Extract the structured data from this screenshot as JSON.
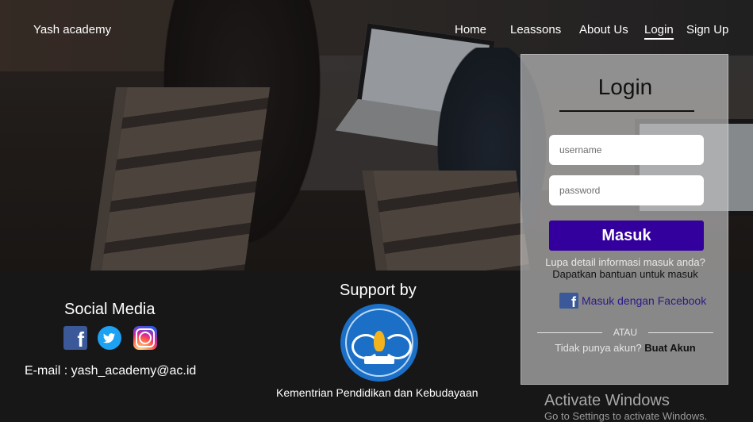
{
  "nav": {
    "brand": "Yash academy",
    "links": [
      {
        "label": "Home"
      },
      {
        "label": "Leassons"
      },
      {
        "label": "About Us"
      },
      {
        "label": "Login"
      },
      {
        "label": "Sign Up"
      }
    ]
  },
  "login": {
    "title": "Login",
    "username_placeholder": "username",
    "password_placeholder": "password",
    "submit_label": "Masuk",
    "forgot_text": "Lupa detail informasi masuk anda?",
    "help_link": "Dapatkan bantuan untuk masuk",
    "facebook_label": "Masuk dengan Facebook",
    "or_text": "ATAU",
    "no_account_text": "Tidak punya akun?",
    "create_account_label": "Buat Akun"
  },
  "footer": {
    "social_title": "Social Media",
    "social_icons": [
      "facebook-icon",
      "twitter-icon",
      "instagram-icon"
    ],
    "email_text": "E-mail : yash_academy@ac.id",
    "support_title": "Support by",
    "ministry_text": "Kementrian Pendidikan dan Kebudayaan"
  },
  "watermark": {
    "title": "Activate Windows",
    "subtitle": "Go to Settings to activate Windows."
  },
  "colors": {
    "primary_button": "#33009e",
    "footer_bg": "#171717",
    "facebook": "#3b5998",
    "twitter": "#1da1f2"
  }
}
